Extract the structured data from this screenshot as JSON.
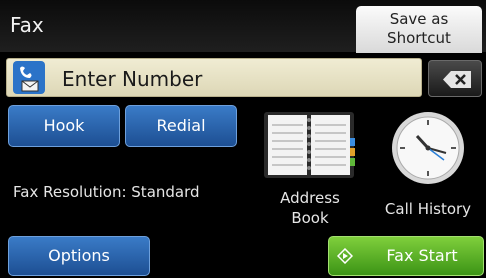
{
  "header": {
    "title": "Fax",
    "shortcut_line1": "Save as",
    "shortcut_line2": "Shortcut"
  },
  "number_field": {
    "placeholder": "Enter Number",
    "icon": "fax-phone-icon"
  },
  "buttons": {
    "hook": "Hook",
    "redial": "Redial",
    "options": "Options",
    "fax_start": "Fax Start"
  },
  "settings": {
    "resolution": "Fax Resolution: Standard"
  },
  "shortcuts": {
    "address_book_line1": "Address",
    "address_book_line2": "Book",
    "call_history": "Call History"
  },
  "colors": {
    "primary_button": "#2a63ab",
    "start_button": "#5cb82a",
    "input_background": "#e8e3c6",
    "background": "#000000"
  }
}
